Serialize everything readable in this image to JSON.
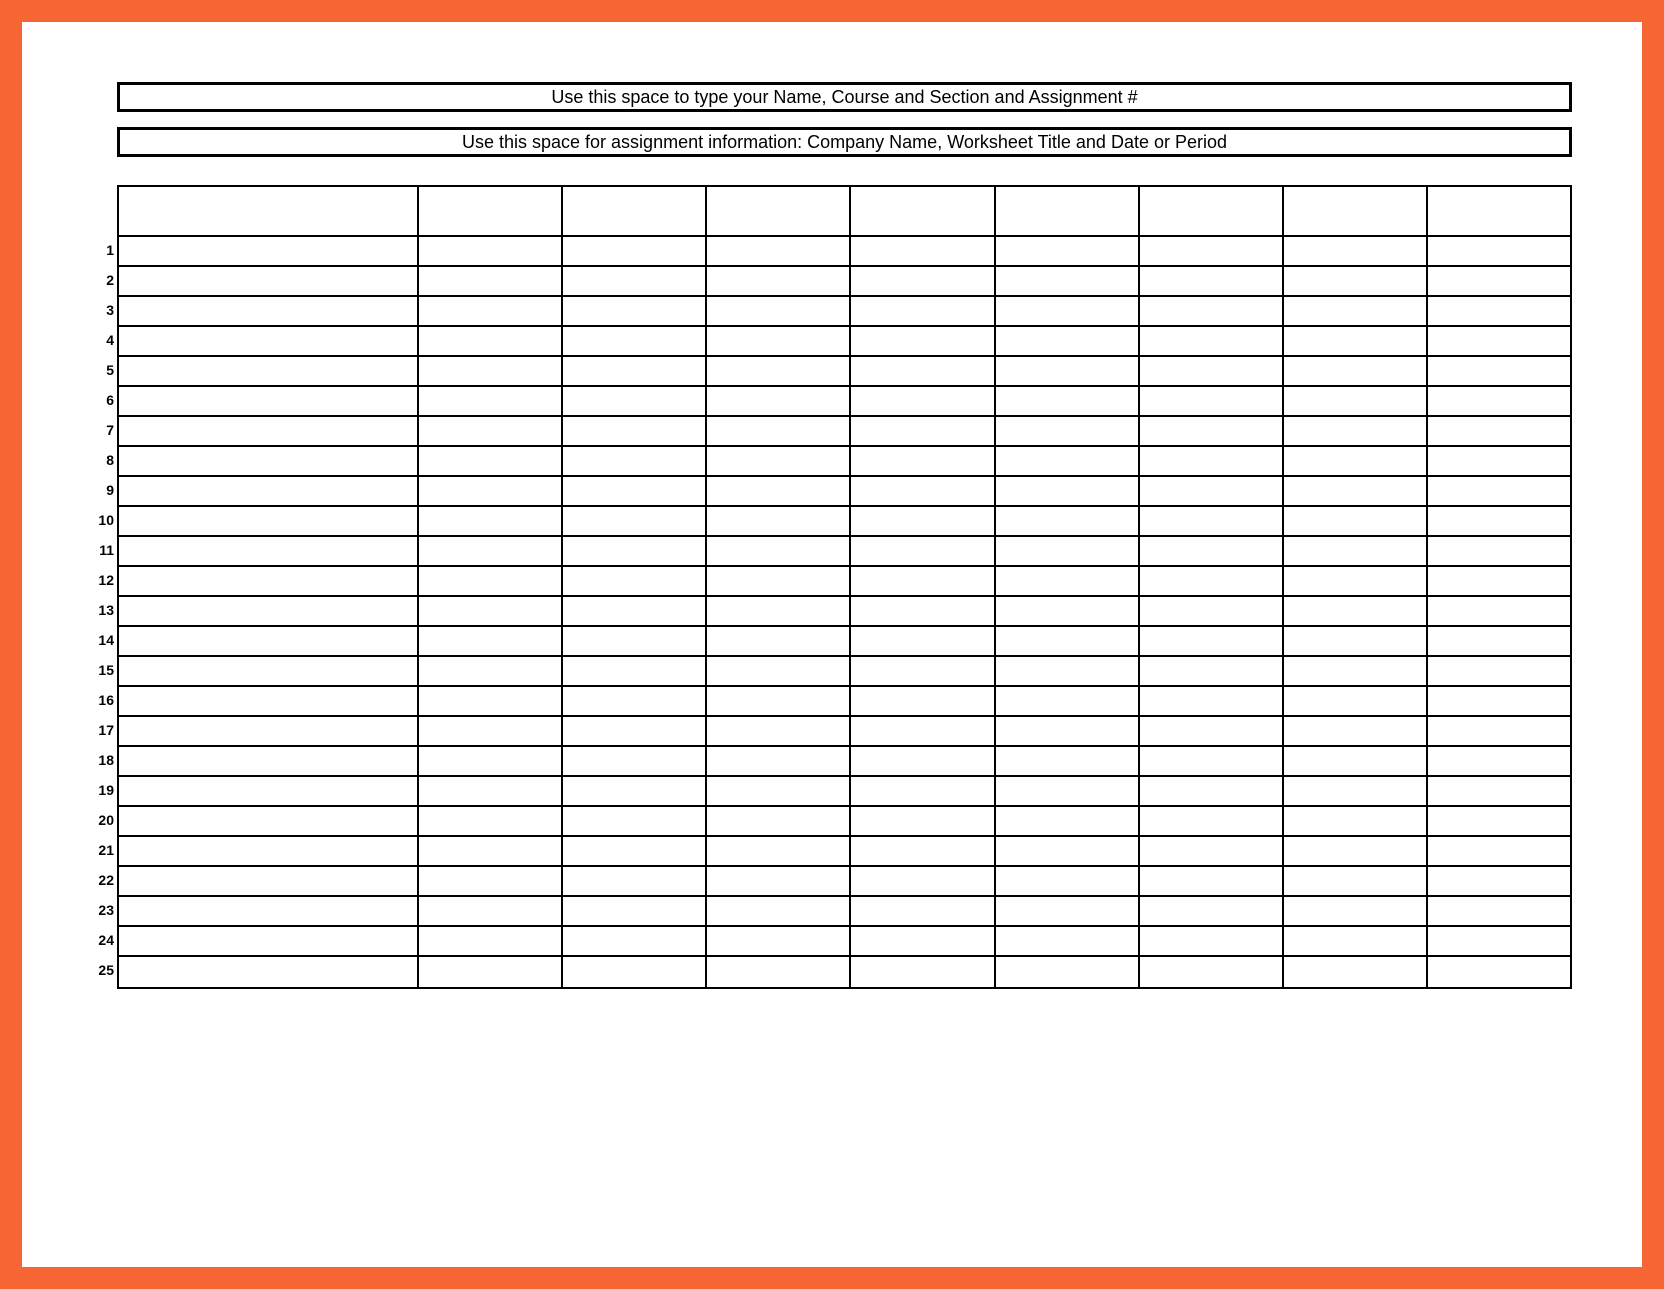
{
  "header": {
    "name_line": "Use this space to type your Name, Course and Section and Assignment #",
    "info_line": "Use this space for assignment information: Company Name, Worksheet Title and Date or Period"
  },
  "grid": {
    "row_numbers": [
      "1",
      "2",
      "3",
      "4",
      "5",
      "6",
      "7",
      "8",
      "9",
      "10",
      "11",
      "12",
      "13",
      "14",
      "15",
      "16",
      "17",
      "18",
      "19",
      "20",
      "21",
      "22",
      "23",
      "24",
      "25"
    ],
    "header_cells": [
      "",
      "",
      "",
      "",
      "",
      "",
      "",
      "",
      ""
    ],
    "rows": [
      [
        "",
        "",
        "",
        "",
        "",
        "",
        "",
        "",
        ""
      ],
      [
        "",
        "",
        "",
        "",
        "",
        "",
        "",
        "",
        ""
      ],
      [
        "",
        "",
        "",
        "",
        "",
        "",
        "",
        "",
        ""
      ],
      [
        "",
        "",
        "",
        "",
        "",
        "",
        "",
        "",
        ""
      ],
      [
        "",
        "",
        "",
        "",
        "",
        "",
        "",
        "",
        ""
      ],
      [
        "",
        "",
        "",
        "",
        "",
        "",
        "",
        "",
        ""
      ],
      [
        "",
        "",
        "",
        "",
        "",
        "",
        "",
        "",
        ""
      ],
      [
        "",
        "",
        "",
        "",
        "",
        "",
        "",
        "",
        ""
      ],
      [
        "",
        "",
        "",
        "",
        "",
        "",
        "",
        "",
        ""
      ],
      [
        "",
        "",
        "",
        "",
        "",
        "",
        "",
        "",
        ""
      ],
      [
        "",
        "",
        "",
        "",
        "",
        "",
        "",
        "",
        ""
      ],
      [
        "",
        "",
        "",
        "",
        "",
        "",
        "",
        "",
        ""
      ],
      [
        "",
        "",
        "",
        "",
        "",
        "",
        "",
        "",
        ""
      ],
      [
        "",
        "",
        "",
        "",
        "",
        "",
        "",
        "",
        ""
      ],
      [
        "",
        "",
        "",
        "",
        "",
        "",
        "",
        "",
        ""
      ],
      [
        "",
        "",
        "",
        "",
        "",
        "",
        "",
        "",
        ""
      ],
      [
        "",
        "",
        "",
        "",
        "",
        "",
        "",
        "",
        ""
      ],
      [
        "",
        "",
        "",
        "",
        "",
        "",
        "",
        "",
        ""
      ],
      [
        "",
        "",
        "",
        "",
        "",
        "",
        "",
        "",
        ""
      ],
      [
        "",
        "",
        "",
        "",
        "",
        "",
        "",
        "",
        ""
      ],
      [
        "",
        "",
        "",
        "",
        "",
        "",
        "",
        "",
        ""
      ],
      [
        "",
        "",
        "",
        "",
        "",
        "",
        "",
        "",
        ""
      ],
      [
        "",
        "",
        "",
        "",
        "",
        "",
        "",
        "",
        ""
      ],
      [
        "",
        "",
        "",
        "",
        "",
        "",
        "",
        "",
        ""
      ],
      [
        "",
        "",
        "",
        "",
        "",
        "",
        "",
        "",
        ""
      ]
    ]
  }
}
